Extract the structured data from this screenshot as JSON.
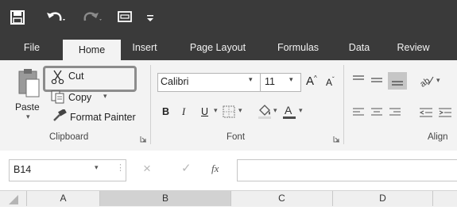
{
  "ribbon_tabs": [
    "File",
    "Home",
    "Insert",
    "Page Layout",
    "Formulas",
    "Data",
    "Review"
  ],
  "clipboard": {
    "paste_label": "Paste",
    "cut_label": "Cut",
    "copy_label": "Copy",
    "format_painter_label": "Format Painter",
    "group_label": "Clipboard"
  },
  "font": {
    "font_name": "Calibri",
    "font_size": "11",
    "bold": "B",
    "italic": "I",
    "underline": "U",
    "group_label": "Font"
  },
  "alignment": {
    "group_label": "Align"
  },
  "formula_bar": {
    "name_box": "B14",
    "fx": "fx",
    "value": ""
  },
  "columns": [
    "A",
    "B",
    "C",
    "D"
  ],
  "colors": {
    "title_bar": "#3a3a3a",
    "ribbon": "#f3f3f3",
    "highlight_outline": "#8c8c8c"
  }
}
